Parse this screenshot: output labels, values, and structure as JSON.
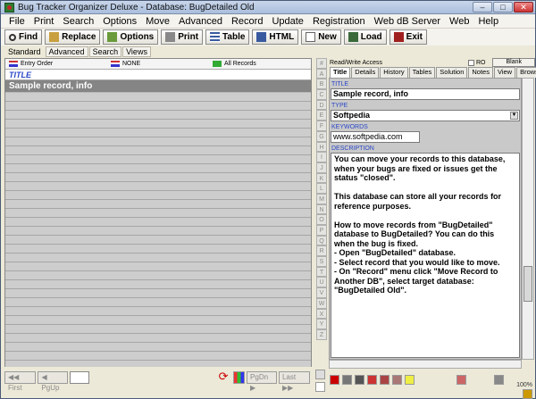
{
  "window": {
    "title": "Bug Tracker Organizer Deluxe - Database: BugDetailed Old"
  },
  "menu": [
    "File",
    "Print",
    "Search",
    "Options",
    "Move",
    "Advanced",
    "Record",
    "Update",
    "Registration",
    "Web dB Server",
    "Web",
    "Help"
  ],
  "toolbar": [
    {
      "label": "Find",
      "icon": "magnifier-icon"
    },
    {
      "label": "Replace",
      "icon": "replace-icon"
    },
    {
      "label": "Options",
      "icon": "options-icon"
    },
    {
      "label": "Print",
      "icon": "printer-icon"
    },
    {
      "label": "Table",
      "icon": "table-icon"
    },
    {
      "label": "HTML",
      "icon": "html-icon"
    },
    {
      "label": "New",
      "icon": "new-document-icon"
    },
    {
      "label": "Load",
      "icon": "load-icon"
    },
    {
      "label": "Exit",
      "icon": "exit-icon"
    }
  ],
  "view_tabs": [
    "Standard",
    "Advanced",
    "Search",
    "Views"
  ],
  "list": {
    "headers": [
      "Entry Order",
      "NONE",
      "All Records"
    ],
    "column_title": "TITLE",
    "rows": [
      "Sample record, info"
    ]
  },
  "nav": {
    "first": "First",
    "prev": "PgUp",
    "next": "PgDn",
    "last": "Last"
  },
  "alphabet": [
    "#",
    "A",
    "B",
    "C",
    "D",
    "E",
    "F",
    "G",
    "H",
    "I",
    "J",
    "K",
    "L",
    "M",
    "N",
    "O",
    "P",
    "Q",
    "R",
    "S",
    "T",
    "U",
    "V",
    "W",
    "X",
    "Y",
    "Z"
  ],
  "right": {
    "access": "Read/Write Access",
    "ro": "RO",
    "blank": "Blank",
    "tabs": [
      "Title",
      "Details",
      "History",
      "Tables",
      "Solution",
      "Notes",
      "View",
      "Browser"
    ],
    "fields": {
      "title_label": "TITLE",
      "title_value": "Sample record, info",
      "type_label": "TYPE",
      "type_value": "Softpedia",
      "keywords_label": "KEYWORDS",
      "keywords_value": "www.softpedia.com",
      "description_label": "DESCRIPTION",
      "description_value": "You can move your records to this database, when your bugs are fixed or issues get the status \"closed\".\n\nThis database can store all your records for reference purposes.\n\nHow to move records from \"BugDetailed\" database to BugDetailed? You can do this when the bug is fixed.\n- Open \"BugDetailed\" database.\n- Select record that you would like to move.\n- On \"Record\" menu click \"Move Record to Another DB\", select target database: \"BugDetailed Old\"."
    },
    "zoom": "100%"
  }
}
